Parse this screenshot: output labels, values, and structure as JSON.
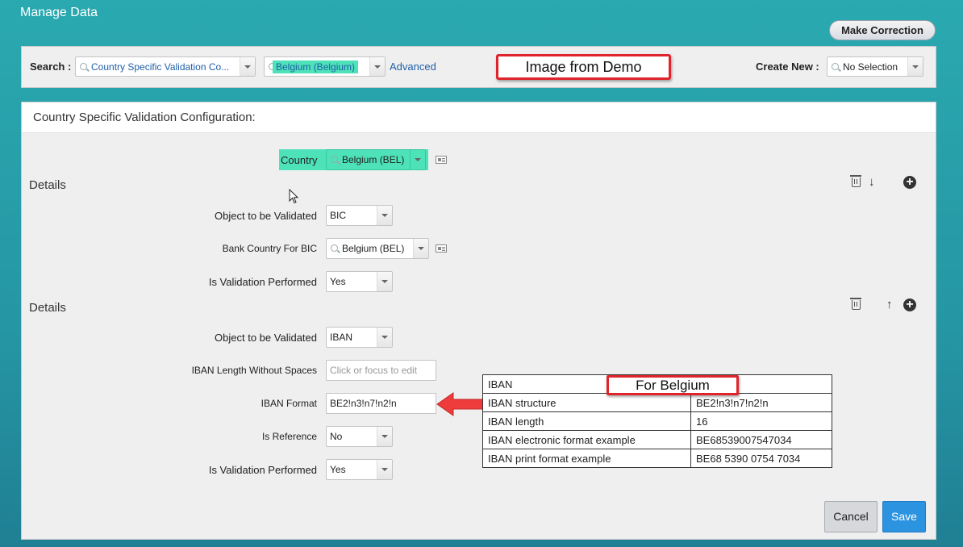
{
  "app": {
    "title": "Manage Data"
  },
  "header": {
    "make_correction_label": "Make Correction"
  },
  "search_bar": {
    "search_label": "Search :",
    "search_type_value": "Country Specific Validation Co...",
    "search_value": "Belgium (Belgium)",
    "advanced_label": "Advanced",
    "create_new_label": "Create New :",
    "create_new_value": "No Selection"
  },
  "annotations": {
    "demo_label": "Image from Demo",
    "belgium_label": "For Belgium"
  },
  "panel": {
    "title": "Country Specific Validation Configuration:",
    "country_label": "Country",
    "country_value": "Belgium (BEL)",
    "details1": {
      "title": "Details",
      "object_label": "Object to be Validated",
      "object_value": "BIC",
      "bank_country_label": "Bank Country For BIC",
      "bank_country_value": "Belgium (BEL)",
      "validation_label": "Is Validation Performed",
      "validation_value": "Yes"
    },
    "details2": {
      "title": "Details",
      "object_label": "Object to be Validated",
      "object_value": "IBAN",
      "length_label": "IBAN Length Without Spaces",
      "length_placeholder": "Click or focus to edit",
      "format_label": "IBAN Format",
      "format_value": "BE2!n3!n7!n2!n",
      "reference_label": "Is Reference",
      "reference_value": "No",
      "validation_label": "Is Validation Performed",
      "validation_value": "Yes"
    }
  },
  "iban_table": {
    "rows": [
      {
        "k": "IBAN",
        "v": ""
      },
      {
        "k": "IBAN structure",
        "v": "BE2!n3!n7!n2!n"
      },
      {
        "k": "IBAN length",
        "v": "16"
      },
      {
        "k": "IBAN electronic format example",
        "v": "BE68539007547034"
      },
      {
        "k": "IBAN print format example",
        "v": "BE68 5390 0754 7034"
      }
    ]
  },
  "buttons": {
    "cancel_label": "Cancel",
    "save_label": "Save"
  },
  "colors": {
    "highlight": "#4ee2b9",
    "accent_red": "#e0242c",
    "save_blue": "#2b93e0"
  }
}
